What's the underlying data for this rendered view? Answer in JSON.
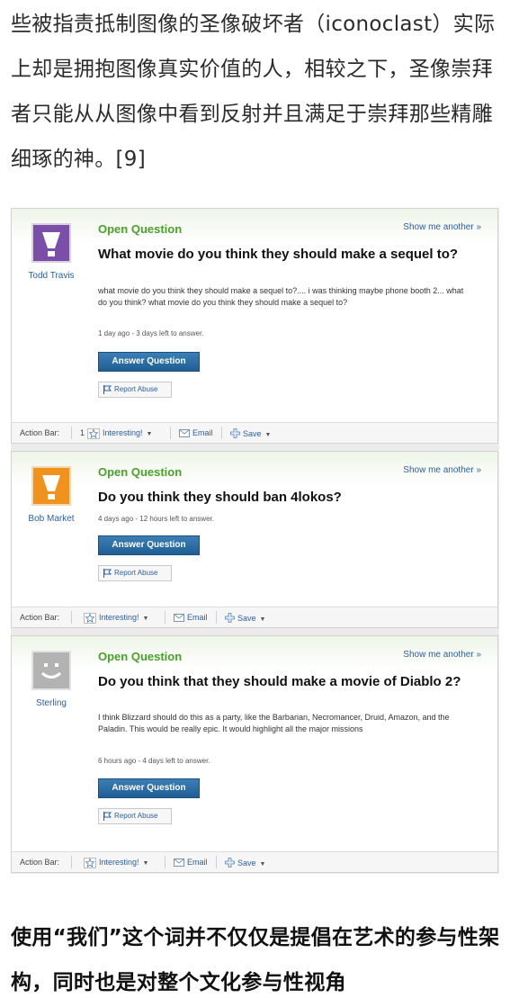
{
  "article": {
    "intro": "些被指责抵制图像的圣像破坏者（iconoclast）实际上却是拥抱图像真实价值的人，相较之下，圣像崇拜者只能从从图像中看到反射并且满足于崇拜那些精雕细琢的神。[9]",
    "outro": "使用“我们”这个词并不仅仅是提倡在艺术的参与性架构，同时也是对整个文化参与性视角"
  },
  "cards": [
    {
      "user": "Todd Travis",
      "avatar_color": "#7b4fa8",
      "label": "Open Question",
      "show_another": "Show me another »",
      "title": "What movie do you think they should make a sequel to?",
      "body": "what movie do you think they should make a sequel to?.... i was thinking maybe phone booth 2... what do you think? what movie do you think they should make a sequel to?",
      "meta": "1 day ago - 3 days left to answer.",
      "answer_label": "Answer Question",
      "report_label": "Report Abuse",
      "action_bar": {
        "label": "Action Bar:",
        "count": "1",
        "interesting": "Interesting!",
        "email": "Email",
        "save": "Save"
      }
    },
    {
      "user": "Bob Market",
      "avatar_color": "#f0921c",
      "label": "Open Question",
      "show_another": "Show me another »",
      "title": "Do you think they should ban 4lokos?",
      "body": "",
      "meta": "4 days ago - 12 hours left to answer.",
      "answer_label": "Answer Question",
      "report_label": "Report Abuse",
      "action_bar": {
        "label": "Action Bar:",
        "count": "",
        "interesting": "Interesting!",
        "email": "Email",
        "save": "Save"
      }
    },
    {
      "user": "Sterling",
      "avatar_color": "#b3b3b3",
      "label": "Open Question",
      "show_another": "Show me another »",
      "title": "Do you think that they should make a movie of Diablo 2?",
      "body": "I think Blizzard should do this as a party, like the Barbarian, Necromancer, Druid, Amazon, and the Paladin. This would be really epic. It would highlight all the major missions",
      "meta": "6 hours ago - 4 days left to answer.",
      "answer_label": "Answer Question",
      "report_label": "Report Abuse",
      "action_bar": {
        "label": "Action Bar:",
        "count": "",
        "interesting": "Interesting!",
        "email": "Email",
        "save": "Save"
      }
    }
  ]
}
